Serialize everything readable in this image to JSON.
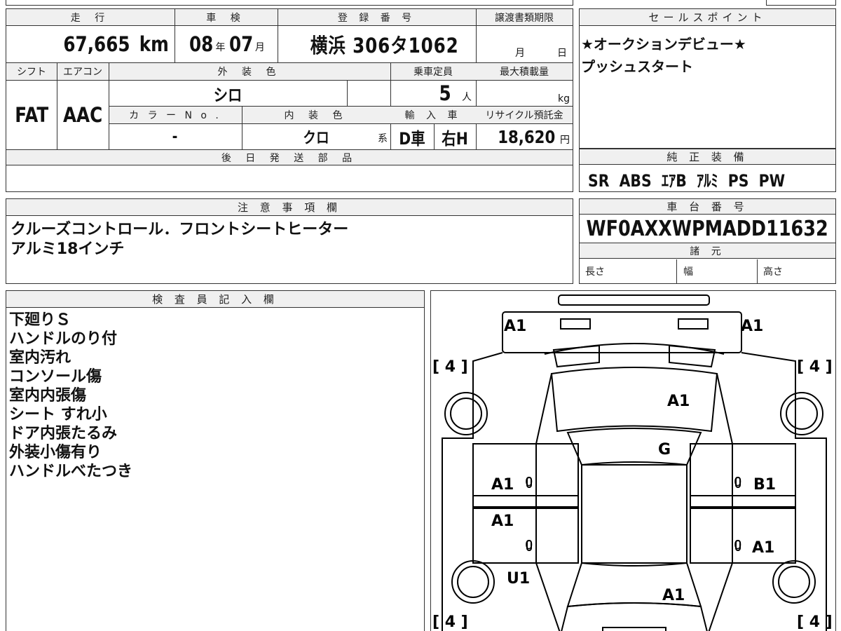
{
  "vehicle": {
    "mileage_label": "走 行",
    "mileage_value": "67,665",
    "mileage_unit": "km",
    "inspection_label": "車 検",
    "inspection_year": "08",
    "inspection_year_unit": "年",
    "inspection_month": "07",
    "inspection_month_unit": "月",
    "registration_label": "登 録 番 号",
    "registration_value": "横浜 306タ1062",
    "transfer_label": "譲渡書類期限",
    "transfer_month_unit": "月",
    "transfer_day_unit": "日",
    "shift_label": "シフト",
    "shift_value": "FAT",
    "aircon_label": "エアコン",
    "aircon_value": "AAC",
    "exterior_color_label": "外 装 色",
    "exterior_color_value": "シロ",
    "capacity_label": "乗車定員",
    "capacity_value": "5",
    "capacity_unit": "人",
    "max_load_label": "最大積載量",
    "max_load_unit": "kg",
    "color_no_label": "カ ラ ー N o .",
    "color_no_value": "-",
    "interior_color_label": "内 装 色",
    "interior_color_value": "クロ",
    "interior_color_suffix": "系",
    "import_label": "輸 入 車",
    "import_value": "D車",
    "steering_value": "右H",
    "recycle_label": "リサイクル預託金",
    "recycle_value": "18,620",
    "recycle_unit": "円"
  },
  "later_parts": {
    "label": "後 日 発 送 部 品"
  },
  "sales_points": {
    "label": "セールスポイント",
    "lines": [
      "★オークションデビュー★",
      "プッシュスタート"
    ]
  },
  "genuine_equipment": {
    "label": "純 正 装 備",
    "value": "SR  ABS  ｴｱB  ｱﾙﾐ  PS  PW"
  },
  "notes": {
    "label": "注 意 事 項 欄",
    "lines": [
      "クルーズコントロール．フロントシートヒーター",
      "アルミ18インチ"
    ]
  },
  "chassis": {
    "label": "車 台 番 号",
    "value": "WF0AXXWPMADD11632"
  },
  "specs": {
    "label": "諸 元",
    "length_label": "長さ",
    "width_label": "幅",
    "height_label": "高さ"
  },
  "inspector": {
    "label": "検 査 員 記 入 欄",
    "lines": [
      "下廻りＳ",
      "ハンドルのり付",
      "室内汚れ",
      "コンソール傷",
      "室内内張傷",
      "シート すれ小",
      "ドア内張たるみ",
      "外装小傷有り",
      "ハンドルべたつき"
    ]
  },
  "diagram": {
    "tire_bracket": "[ 4 ]",
    "marks": {
      "front_left": "A1",
      "front_right": "A1",
      "hood": "A1",
      "windshield": "G",
      "left_front_door": "A1",
      "left_front_door_num": "0",
      "right_front_door": "B1",
      "right_front_door_num": "0",
      "left_rear_door": "A1",
      "left_rear_door_num": "0",
      "right_rear_door": "A1",
      "right_rear_door_num": "0",
      "left_rear_quarter": "U1",
      "trunk": "A1"
    }
  }
}
